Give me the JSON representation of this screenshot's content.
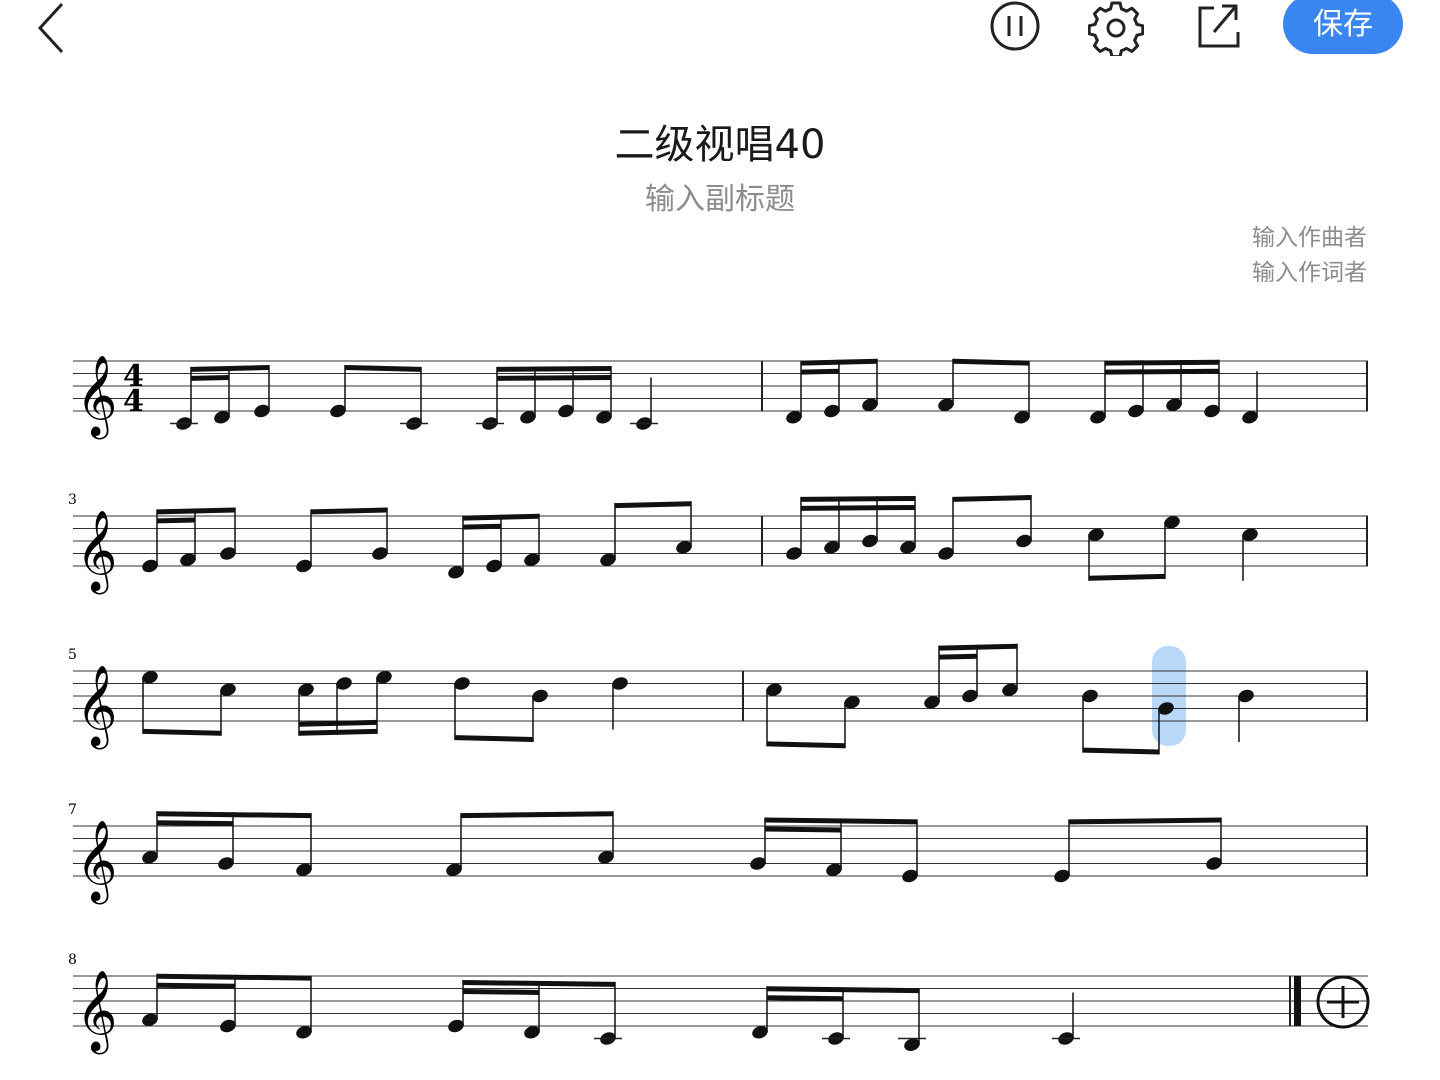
{
  "header": {
    "back_icon": "chevron-left-icon",
    "play_icon": "pause-circle-icon",
    "settings_icon": "gear-icon",
    "share_icon": "share-external-icon",
    "save_label": "保存",
    "accent_color": "#3a86f0"
  },
  "score": {
    "title": "二级视唱40",
    "subtitle": "输入副标题",
    "composer": "输入作曲者",
    "lyricist": "输入作词者",
    "time_signature": {
      "top": "4",
      "bottom": "4"
    },
    "clef": "treble",
    "selection_color": "#b9d8f7",
    "systems": [
      {
        "measure_label": "",
        "systems_bar": []
      },
      {
        "measure_label": "3"
      },
      {
        "measure_label": "5"
      },
      {
        "measure_label": "7"
      },
      {
        "measure_label": "8"
      }
    ],
    "add_icon": "plus-circle-icon"
  }
}
